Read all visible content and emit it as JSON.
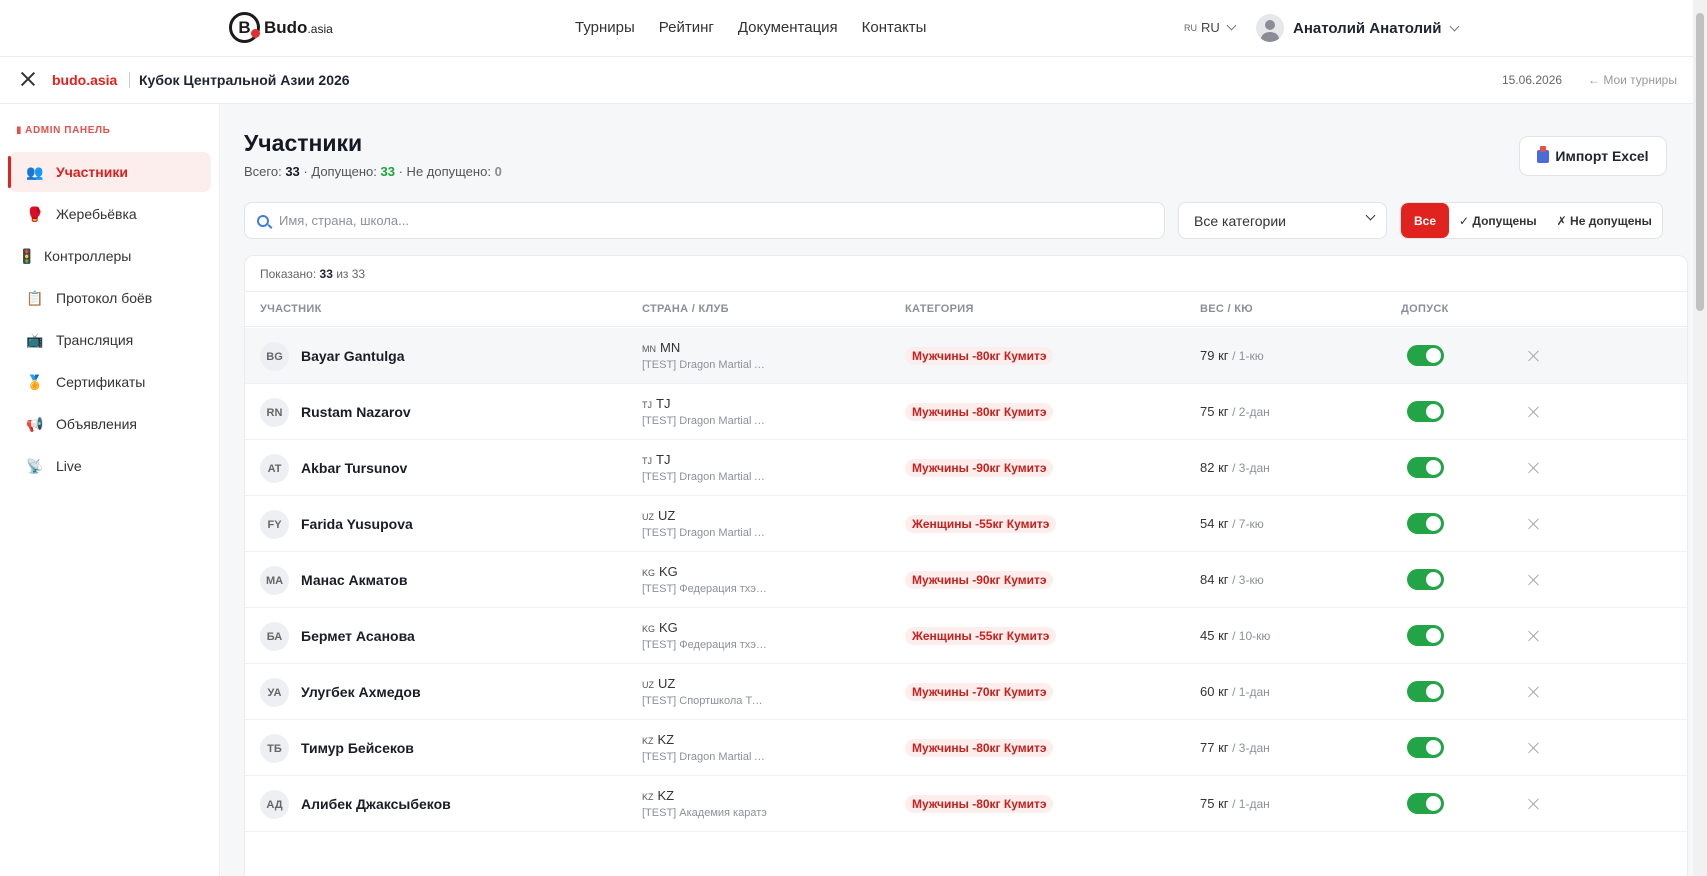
{
  "topnav": {
    "logo_main": "Budo",
    "logo_suffix": ".asia",
    "menu": [
      "Турниры",
      "Рейтинг",
      "Документация",
      "Контакты"
    ],
    "lang_code": "RU",
    "lang_label": "RU",
    "user_name": "Анатолий Анатолий"
  },
  "subbar": {
    "brand": "budo.asia",
    "tournament": "Кубок Центральной Азии 2026",
    "date": "15.06.2026",
    "my_tours": "← Мои турниры"
  },
  "sidebar": {
    "admin_label": "ADMIN ПАНЕЛЬ",
    "items": [
      {
        "label": "Участники",
        "icon": "👥"
      },
      {
        "label": "Жеребьёвка",
        "icon": "🥊"
      },
      {
        "label": "Контроллеры",
        "icon": "🚦"
      },
      {
        "label": "Протокол боёв",
        "icon": "📋"
      },
      {
        "label": "Трансляция",
        "icon": "📺"
      },
      {
        "label": "Сертификаты",
        "icon": "🏅"
      },
      {
        "label": "Объявления",
        "icon": "📢"
      },
      {
        "label": "Live",
        "icon": "📡"
      }
    ]
  },
  "main": {
    "title": "Участники",
    "stats": {
      "total_label": "Всего:",
      "total": "33",
      "ok_label": "· Допущено:",
      "ok": "33",
      "no_label": "· Не допущено:",
      "no": "0"
    },
    "import_label": "Импорт Excel",
    "search_placeholder": "Имя, страна, школа...",
    "category_select": "Все категории",
    "filters": [
      "Все",
      "✓ Допущены",
      "✗ Не допущены"
    ],
    "shown": {
      "label": "Показано:",
      "count": "33",
      "of": "из 33"
    },
    "columns": [
      "УЧАСТНИК",
      "СТРАНА / КЛУБ",
      "КАТЕГОРИЯ",
      "ВЕС / КЮ",
      "ДОПУСК"
    ],
    "rows": [
      {
        "initials": "BG",
        "name": "Bayar Gantulga",
        "cc": "MN",
        "country": "MN",
        "club": "[TEST] Dragon Martial Arts",
        "category": "Мужчины -80кг Кумитэ",
        "weight": "79 кг",
        "rank": "/ 1-кю",
        "admitted": true
      },
      {
        "initials": "RN",
        "name": "Rustam Nazarov",
        "cc": "TJ",
        "country": "TJ",
        "club": "[TEST] Dragon Martial Arts",
        "category": "Мужчины -80кг Кумитэ",
        "weight": "75 кг",
        "rank": "/ 2-дан",
        "admitted": true
      },
      {
        "initials": "AT",
        "name": "Akbar Tursunov",
        "cc": "TJ",
        "country": "TJ",
        "club": "[TEST] Dragon Martial Arts",
        "category": "Мужчины -90кг Кумитэ",
        "weight": "82 кг",
        "rank": "/ 3-дан",
        "admitted": true
      },
      {
        "initials": "FY",
        "name": "Farida Yusupova",
        "cc": "UZ",
        "country": "UZ",
        "club": "[TEST] Dragon Martial Arts",
        "category": "Женщины -55кг Кумитэ",
        "weight": "54 кг",
        "rank": "/ 7-кю",
        "admitted": true
      },
      {
        "initials": "МА",
        "name": "Манас Акматов",
        "cc": "KG",
        "country": "KG",
        "club": "[TEST] Федерация тхэквондо",
        "category": "Мужчины -90кг Кумитэ",
        "weight": "84 кг",
        "rank": "/ 3-кю",
        "admitted": true
      },
      {
        "initials": "БА",
        "name": "Бермет Асанова",
        "cc": "KG",
        "country": "KG",
        "club": "[TEST] Федерация тхэквондо",
        "category": "Женщины -55кг Кумитэ",
        "weight": "45 кг",
        "rank": "/ 10-кю",
        "admitted": true
      },
      {
        "initials": "УА",
        "name": "Улугбек Ахмедов",
        "cc": "UZ",
        "country": "UZ",
        "club": "[TEST] Спортшкола Ташкент",
        "category": "Мужчины -70кг Кумитэ",
        "weight": "60 кг",
        "rank": "/ 1-дан",
        "admitted": true
      },
      {
        "initials": "ТБ",
        "name": "Тимур Бейсеков",
        "cc": "KZ",
        "country": "KZ",
        "club": "[TEST] Dragon Martial Arts",
        "category": "Мужчины -80кг Кумитэ",
        "weight": "77 кг",
        "rank": "/ 3-дан",
        "admitted": true
      },
      {
        "initials": "АД",
        "name": "Алибек Джаксыбеков",
        "cc": "KZ",
        "country": "KZ",
        "club": "[TEST] Академия каратэ",
        "category": "Мужчины -80кг Кумитэ",
        "weight": "75 кг",
        "rank": "/ 1-дан",
        "admitted": true
      }
    ]
  },
  "colors": {
    "accent": "#e0231f",
    "success": "#22a447"
  }
}
